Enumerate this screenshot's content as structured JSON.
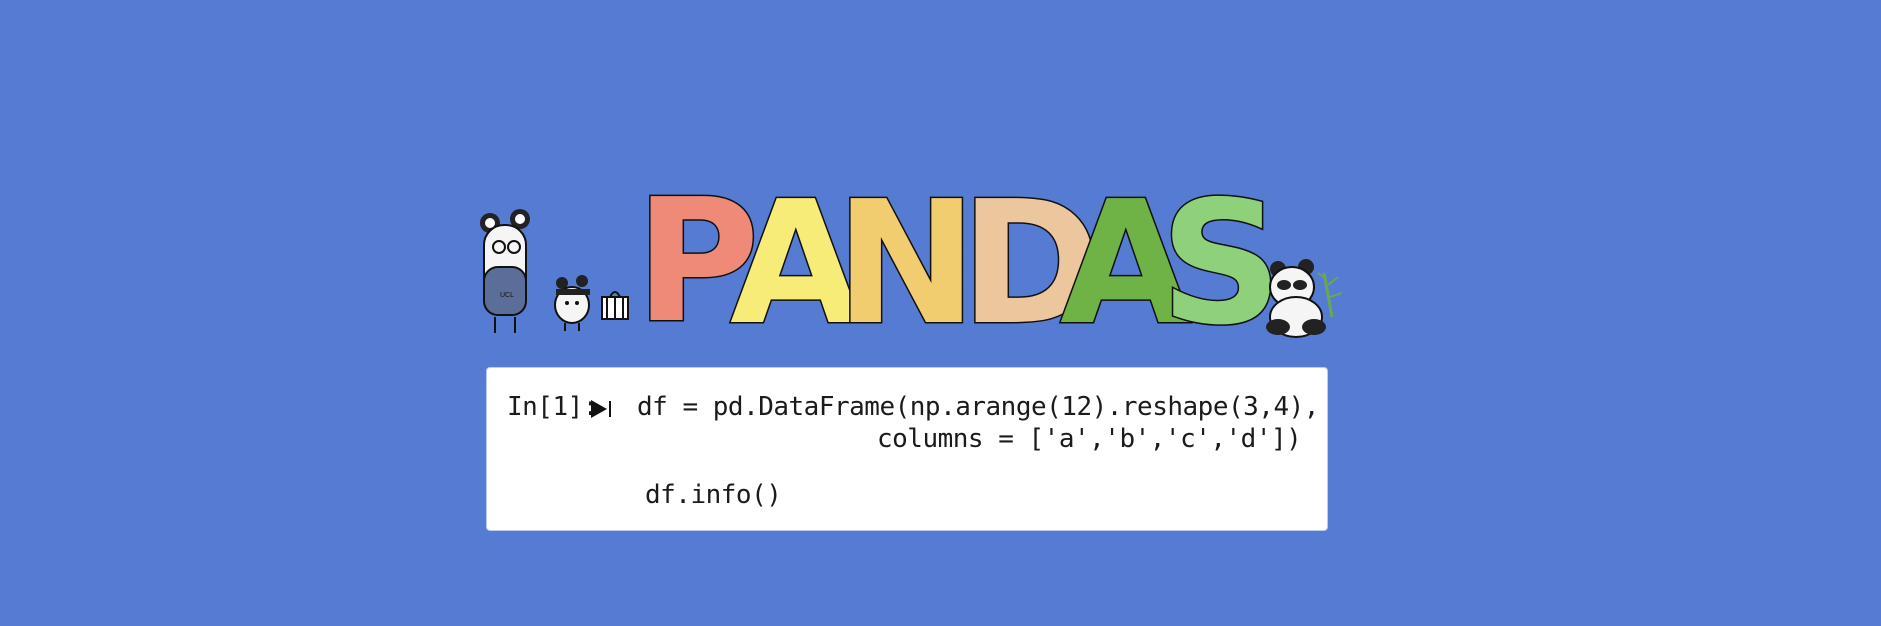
{
  "banner": {
    "title": "PANDAS",
    "letters": [
      {
        "char": "P",
        "color": "#f08a78"
      },
      {
        "char": "A",
        "color": "#f7ec78"
      },
      {
        "char": "N",
        "color": "#f2cd70"
      },
      {
        "char": "D",
        "color": "#ecc79d"
      },
      {
        "char": "A",
        "color": "#6fb347"
      },
      {
        "char": "S",
        "color": "#8fd07a"
      }
    ],
    "background_color": "#557bd2"
  },
  "characters": {
    "left_tall": {
      "badge": "UCL",
      "icon": "panda-character-icon"
    },
    "left_small": {
      "icon": "panda-character-icon"
    },
    "gift": {
      "icon": "gift-box-icon"
    },
    "right": {
      "icon": "panda-with-bamboo-icon"
    }
  },
  "notebook_cell": {
    "prompt": "In[1]:",
    "run_icon": "play-icon",
    "line1": "df = pd.DataFrame(np.arange(12).reshape(3,4),",
    "line2": "columns = ['a','b','c','d'])",
    "line3": "df.info()"
  }
}
